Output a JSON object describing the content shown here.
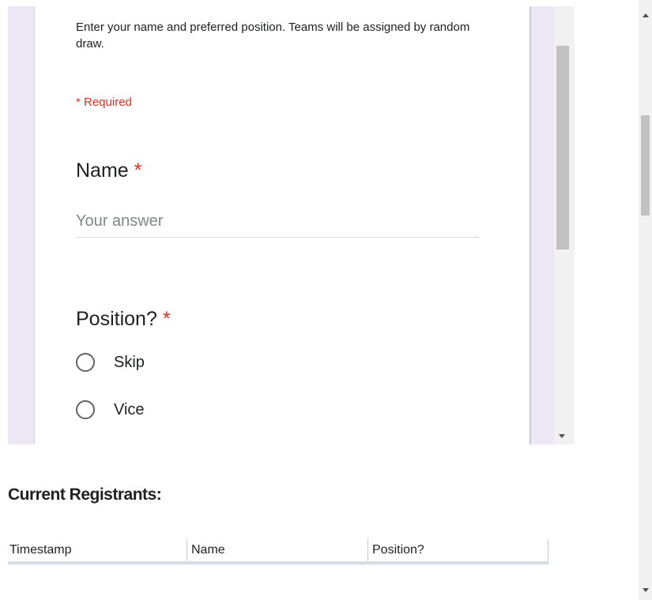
{
  "form": {
    "description": "Enter your name and preferred position.  Teams will be assigned by random draw.",
    "required_note": "* Required",
    "name_question": {
      "label": "Name",
      "required_mark": "*",
      "placeholder": "Your answer"
    },
    "position_question": {
      "label": "Position?",
      "required_mark": "*",
      "options": [
        {
          "label": "Skip"
        },
        {
          "label": "Vice"
        }
      ]
    }
  },
  "registrants": {
    "title": "Current Registrants:",
    "columns": [
      "Timestamp",
      "Name",
      "Position?"
    ]
  },
  "colors": {
    "form_background": "#ede7f6",
    "required_red": "#d93025"
  }
}
